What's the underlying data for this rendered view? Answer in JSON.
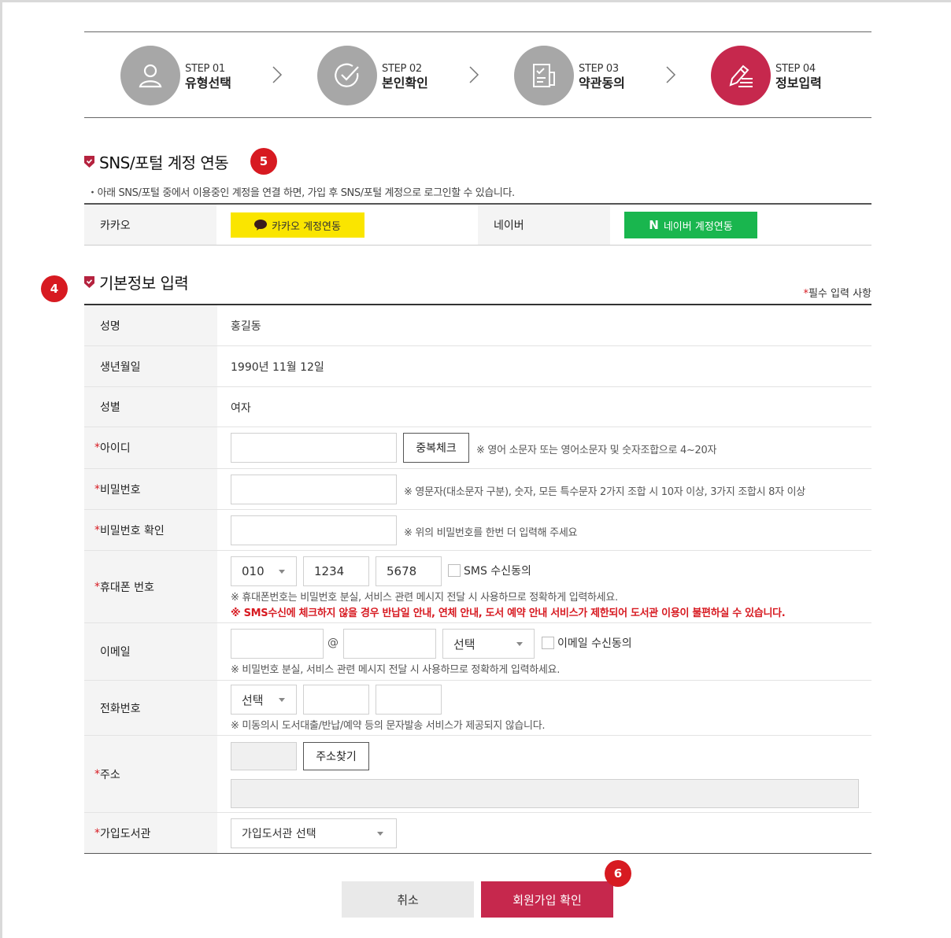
{
  "steps": [
    {
      "num": "STEP 01",
      "name": "유형선택",
      "icon": "person-icon",
      "active": false
    },
    {
      "num": "STEP 02",
      "name": "본인확인",
      "icon": "check-circle-icon",
      "active": false
    },
    {
      "num": "STEP 03",
      "name": "약관동의",
      "icon": "document-check-icon",
      "active": false
    },
    {
      "num": "STEP 04",
      "name": "정보입력",
      "icon": "pen-write-icon",
      "active": true
    }
  ],
  "sns": {
    "title": "SNS/포털 계정 연동",
    "badge": "5",
    "note": "・아래 SNS/포털 중에서 이용중인 계정을 연결 하면, 가입 후 SNS/포털 계정으로 로그인할 수 있습니다.",
    "kakao_label": "카카오",
    "kakao_button": "카카오 계정연동",
    "naver_label": "네이버",
    "naver_button": "네이버 계정연동",
    "naver_logo": "N"
  },
  "basic": {
    "title": "기본정보 입력",
    "badge": "4",
    "required_star": "*",
    "required_note": "필수 입력 사항"
  },
  "form": {
    "name_label": "성명",
    "name_value": "홍길동",
    "birth_label": "생년월일",
    "birth_value": "1990년 11월 12일",
    "gender_label": "성별",
    "gender_value": "여자",
    "id_label": "아이디",
    "id_check_button": "중복체크",
    "id_hint": "※ 영어 소문자 또는 영어소문자 및 숫자조합으로 4~20자",
    "pw_label": "비밀번호",
    "pw_hint": "※ 영문자(대소문자 구분), 숫자, 모든 특수문자 2가지 조합 시 10자 이상, 3가지 조합시 8자 이상",
    "pw_confirm_label": "비밀번호 확인",
    "pw_confirm_hint": "※ 위의 비밀번호를 한번 더 입력해 주세요",
    "phone_label": "휴대폰 번호",
    "phone_prefix": "010",
    "phone_mid": "1234",
    "phone_last": "5678",
    "sms_label": "SMS 수신동의",
    "phone_hint": "※ 휴대폰번호는 비밀번호 분실, 서비스 관련 메시지 전달 시 사용하므로 정확하게 입력하세요.",
    "phone_warning": "※ SMS수신에 체크하지 않을 경우 반납일 안내, 연체 안내, 도서 예약 안내 서비스가 제한되어 도서관 이용이 불편하실 수 있습니다.",
    "email_label": "이메일",
    "email_at": "@",
    "email_select": "선택",
    "email_agree": "이메일 수신동의",
    "email_hint": "※  비밀번호 분실, 서비스 관련 메시지 전달 시 사용하므로 정확하게 입력하세요.",
    "tel_label": "전화번호",
    "tel_select": "선택",
    "tel_hint": "※ 미동의시 도서대출/반납/예약 등의 문자발송 서비스가 제공되지 않습니다.",
    "address_label": "주소",
    "address_button": "주소찾기",
    "library_label": "가입도서관",
    "library_select": "가입도서관 선택"
  },
  "buttons": {
    "cancel": "취소",
    "submit": "회원가입 확인",
    "submit_badge": "6"
  },
  "colors": {
    "accent": "#c6284d",
    "badge": "#d71a21",
    "kakao": "#fae500",
    "naver": "#19b64e",
    "step_inactive": "#a7a7a7"
  }
}
